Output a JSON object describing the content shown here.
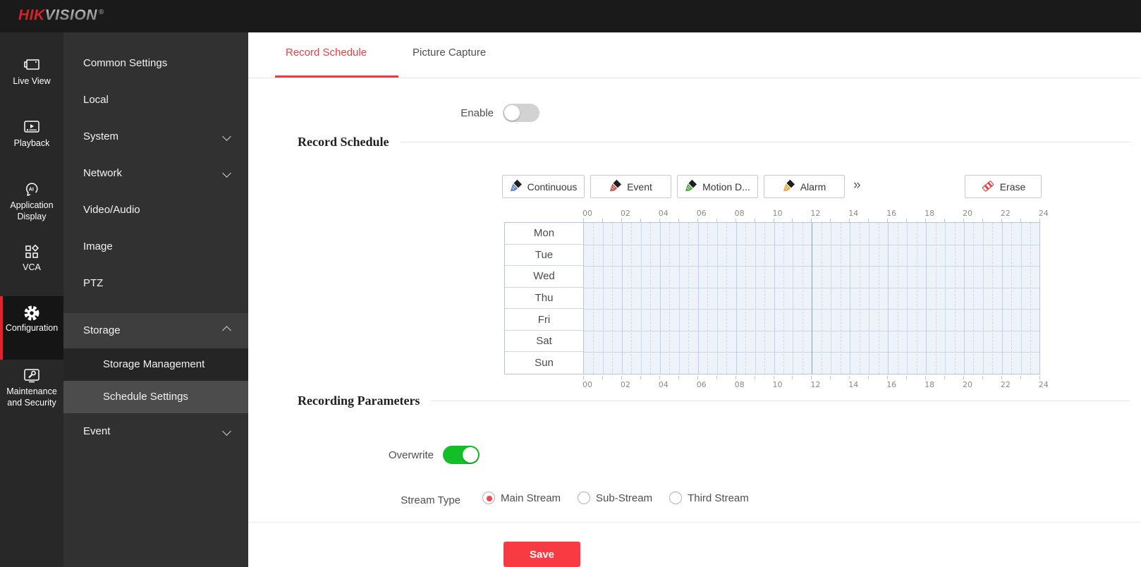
{
  "header": {
    "logo_hik": "HIK",
    "logo_vision": "VISION",
    "logo_reg": "®"
  },
  "primary_nav": {
    "items": [
      {
        "name": "live-view",
        "icon": "live-view-icon",
        "lines": [
          "Live View"
        ],
        "active": false
      },
      {
        "name": "playback",
        "icon": "playback-icon",
        "lines": [
          "Playback"
        ],
        "active": false
      },
      {
        "name": "application-display",
        "icon": "application-display-icon",
        "lines": [
          "Application",
          "Display"
        ],
        "active": false
      },
      {
        "name": "vca",
        "icon": "vca-icon",
        "lines": [
          "VCA"
        ],
        "active": false
      },
      {
        "name": "configuration",
        "icon": "configuration-icon",
        "lines": [
          "Configuration"
        ],
        "active": true
      },
      {
        "name": "maintenance-and-security",
        "icon": "maintenance-security-icon",
        "lines": [
          "Maintenance",
          "and Security"
        ],
        "active": false
      }
    ]
  },
  "secondary_nav": {
    "items": [
      {
        "name": "common-settings",
        "label": "Common Settings"
      },
      {
        "name": "local",
        "label": "Local"
      },
      {
        "name": "system",
        "label": "System",
        "chevron": "down"
      },
      {
        "name": "network",
        "label": "Network",
        "chevron": "down"
      },
      {
        "name": "video-audio",
        "label": "Video/Audio"
      },
      {
        "name": "image",
        "label": "Image"
      },
      {
        "name": "ptz",
        "label": "PTZ"
      },
      {
        "name": "storage",
        "label": "Storage",
        "chevron": "up",
        "state": "expanded-parent"
      },
      {
        "name": "storage-management",
        "label": "Storage Management",
        "child": true,
        "state": "dark"
      },
      {
        "name": "schedule-settings",
        "label": "Schedule Settings",
        "child": true,
        "state": "selected"
      },
      {
        "name": "event",
        "label": "Event",
        "chevron": "down"
      }
    ]
  },
  "tabs": [
    {
      "name": "record-schedule",
      "label": "Record Schedule",
      "active": true
    },
    {
      "name": "picture-capture",
      "label": "Picture Capture",
      "active": false
    }
  ],
  "enable": {
    "label": "Enable",
    "state": "off"
  },
  "record_schedule": {
    "title": "Record Schedule",
    "tools": [
      {
        "name": "continuous",
        "label": "Continuous",
        "color": "#5c7fd8"
      },
      {
        "name": "event",
        "label": "Event",
        "color": "#d04f43"
      },
      {
        "name": "motion-detection",
        "label": "Motion D...",
        "color": "#57a349"
      },
      {
        "name": "alarm",
        "label": "Alarm",
        "color": "#eda73a"
      }
    ],
    "more_label": "»",
    "erase_label": "Erase",
    "erase_color": "#e0484f",
    "grid": {
      "days": [
        "Mon",
        "Tue",
        "Wed",
        "Thu",
        "Fri",
        "Sat",
        "Sun"
      ],
      "hour_labels": [
        "00",
        "02",
        "04",
        "06",
        "08",
        "10",
        "12",
        "14",
        "16",
        "18",
        "20",
        "22",
        "24"
      ],
      "marker_hour": 12,
      "marker_color": "#7fa3cf"
    }
  },
  "recording_parameters": {
    "title": "Recording Parameters",
    "overwrite_label": "Overwrite",
    "overwrite_state": "on",
    "stream_type_label": "Stream Type",
    "stream_options": [
      {
        "label": "Main Stream",
        "selected": true
      },
      {
        "label": "Sub-Stream",
        "selected": false
      },
      {
        "label": "Third Stream",
        "selected": false
      }
    ]
  },
  "save_label": "Save",
  "colors": {
    "accent_red": "#f13c44",
    "toggle_on_green": "#12bf26",
    "active_nav_bar_red": "#e1252c"
  }
}
